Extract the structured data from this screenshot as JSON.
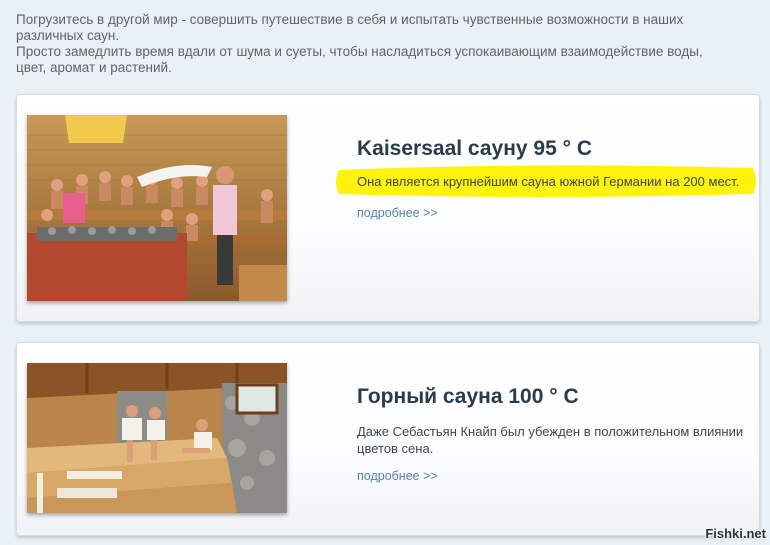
{
  "intro": {
    "line1": "Погрузитесь в другой мир - совершить путешествие в себя и испытать чувственные возможности в наших различных саун.",
    "line2": "Просто замедлить время вдали от шума и суеты, чтобы насладиться успокаивающим взаимодействие воды, цвет, аромат и растений."
  },
  "cards": [
    {
      "title": "Kaisersaal сауну 95 ° C",
      "description": "Она является крупнейшим сауна южной Германии на 200 мест.",
      "more": "подробнее >>",
      "highlight_color": "#fff200"
    },
    {
      "title": "Горный сауна 100 ° C",
      "description": "Даже Себастьян Кнайп был убежден в положительном влиянии цветов сена.",
      "more": "подробнее >>"
    }
  ],
  "watermark": "Fishki.net",
  "colors": {
    "page_bg": "#e9f1f7",
    "title": "#2a3b4b",
    "link": "#5a82a8",
    "intro_text": "#5f6368"
  }
}
